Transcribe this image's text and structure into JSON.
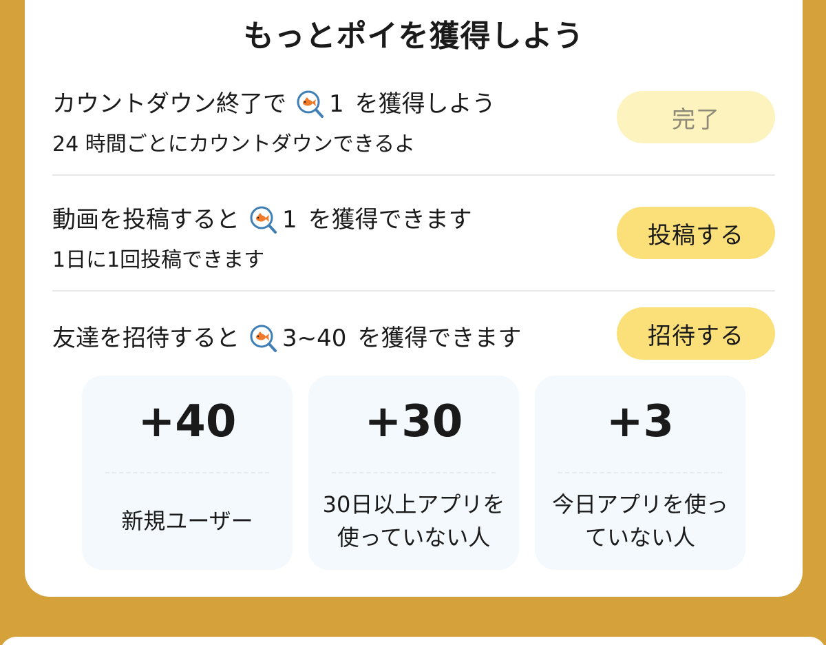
{
  "section": {
    "title": "もっとポイを獲得しよう"
  },
  "tasks": [
    {
      "text_before": "カウントダウン終了で",
      "amount": "1",
      "text_after": "を獲得しよう",
      "subtext": "24 時間ごとにカウントダウンできるよ",
      "button": "完了",
      "icon": "poi-goldfish-icon"
    },
    {
      "text_before": "動画を投稿すると",
      "amount": "1",
      "text_after": "を獲得できます",
      "subtext": "1日に1回投稿できます",
      "button": "投稿する",
      "icon": "poi-goldfish-icon"
    },
    {
      "text_before": "友達を招待すると",
      "amount": "3~40",
      "text_after": "を獲得できます",
      "button": "招待する",
      "icon": "poi-goldfish-icon"
    }
  ],
  "bonuses": [
    {
      "value": "+40",
      "desc": "新規ユーザー"
    },
    {
      "value": "+30",
      "desc": "30日以上アプリを使っていない人"
    },
    {
      "value": "+3",
      "desc": "今日アプリを使っていない人"
    }
  ],
  "colors": {
    "background": "#D4A13A",
    "button": "#FBE07A",
    "button_done": "#FDF3BE",
    "bonus_card": "#F3F9FD"
  }
}
